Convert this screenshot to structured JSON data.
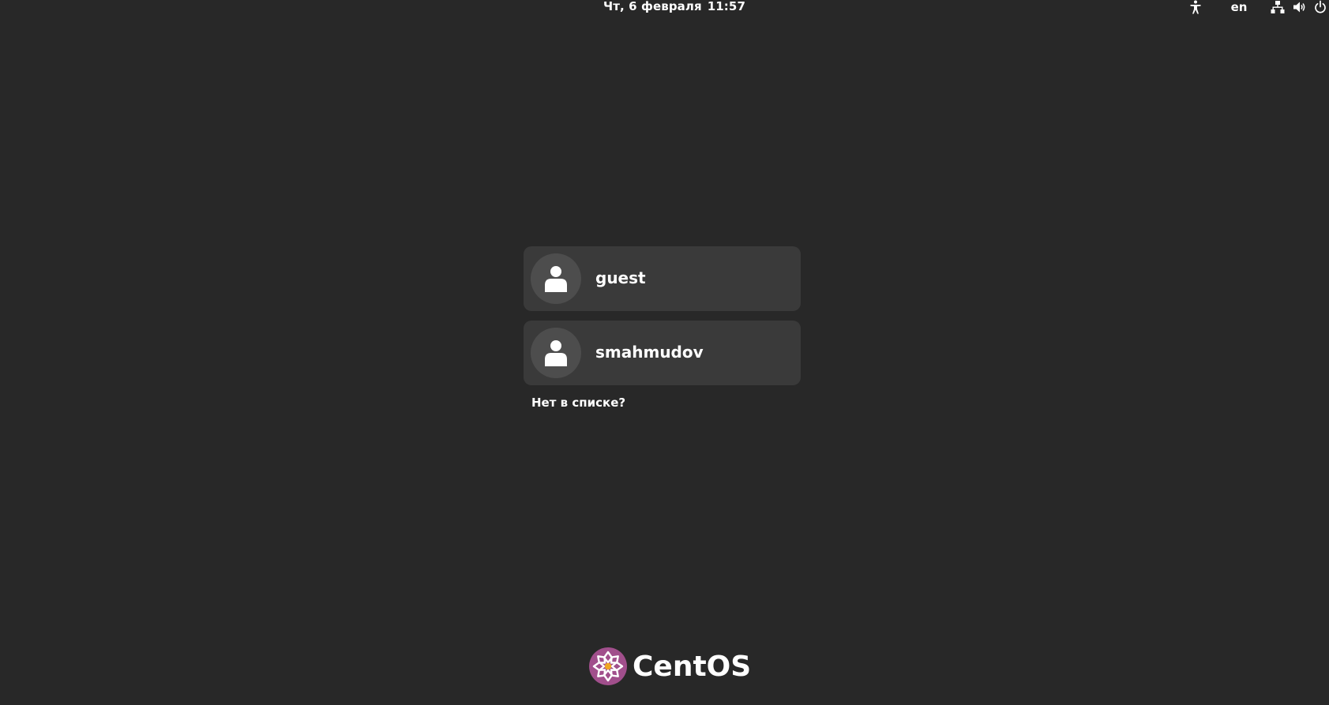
{
  "topbar": {
    "date": "Чт, 6 февраля",
    "time": "11:57",
    "keyboard_layout": "en",
    "icons": [
      "accessibility-icon",
      "network-icon",
      "volume-icon",
      "power-icon"
    ]
  },
  "users": [
    {
      "name": "guest"
    },
    {
      "name": "smahmudov"
    }
  ],
  "not_listed_label": "Нет в списке?",
  "logo": {
    "text": "CentOS",
    "colors": {
      "circle": "#a14f8c",
      "center": "#efa724"
    }
  }
}
